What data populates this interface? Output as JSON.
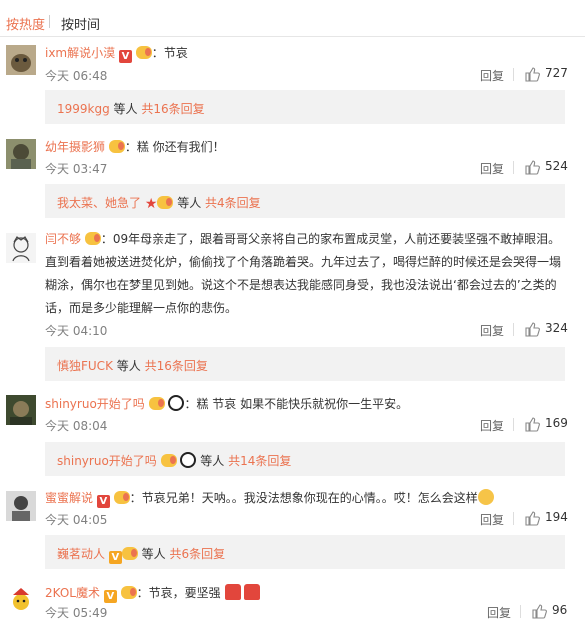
{
  "sort": {
    "hot_label": "按热度",
    "time_label": "按时间"
  },
  "comments": [
    {
      "username": "ixm解说小漠",
      "sep": "：",
      "text": "节哀",
      "time": "今天 06:48",
      "reply_label": "回复",
      "likes": "727",
      "sub_names": "1999kgg",
      "sub_mid": " 等人 ",
      "sub_count": "共16条回复"
    },
    {
      "username": "幼年摄影狮",
      "sep": "：",
      "text": "糕 你还有我们！",
      "time": "今天 03:47",
      "reply_label": "回复",
      "likes": "524",
      "sub_names": "我太菜、她急了",
      "sub_mid": " 等人 ",
      "sub_count": "共4条回复"
    },
    {
      "username": "闫不够",
      "sep": "：",
      "line1": "09年母亲走了，跟着哥哥父亲将自己的家布置成灵堂，人前还要装坚强不敢掉眼泪。",
      "line2": "直到看着她被送进焚化炉，偷偷找了个角落跪着哭。九年过去了，喝得烂醉的时候还是会哭得一塌",
      "line3": "糊涂，偶尔也在梦里见到她。说这个不是想表达我能感同身受，我也没法说出‘都会过去的’之类的",
      "line4": "话，而是多少能理解一点你的悲伤。",
      "time": "今天 04:10",
      "reply_label": "回复",
      "likes": "324",
      "sub_names": "慎独FUCK",
      "sub_mid": " 等人 ",
      "sub_count": "共16条回复"
    },
    {
      "username": "shinyruo开始了吗",
      "sep": "：",
      "text": "糕 节哀  如果不能快乐就祝你一生平安。",
      "time": "今天 08:04",
      "reply_label": "回复",
      "likes": "169",
      "sub_names": "shinyruo开始了吗",
      "sub_mid": " 等人 ",
      "sub_count": "共14条回复"
    },
    {
      "username": "蜜蜜解说",
      "sep": "：",
      "text": "节哀兄弟！天呐。。我没法想象你现在的心情。。哎！怎么会这样",
      "time": "今天 04:05",
      "reply_label": "回复",
      "likes": "194",
      "sub_names": "巍茗动人",
      "sub_mid": " 等人 ",
      "sub_count": "共6条回复"
    },
    {
      "username": "2KOL魔术",
      "sep": "：",
      "text": "节哀，要坚强",
      "time": "今天 05:49",
      "reply_label": "回复",
      "likes": "96"
    }
  ],
  "colors": {
    "accent": "#eb7350",
    "subbg": "#f2f2f2",
    "text": "#333333",
    "muted": "#808080"
  }
}
